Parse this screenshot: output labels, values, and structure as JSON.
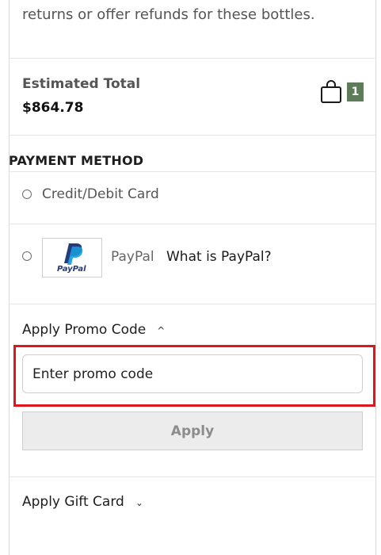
{
  "notice": {
    "text": "returns or offer refunds for these bottles."
  },
  "summary": {
    "estimated_total_label": "Estimated Total",
    "estimated_total_value": "$864.78",
    "cart_count": "1"
  },
  "payment": {
    "heading": "PAYMENT METHOD",
    "options": [
      {
        "label": "Credit/Debit Card"
      },
      {
        "label": "PayPal",
        "link": "What is PayPal?",
        "logo_text": "PayPal"
      }
    ]
  },
  "promo": {
    "toggle_label": "Apply Promo Code",
    "input_placeholder": "Enter promo code",
    "apply_label": "Apply"
  },
  "gift_card": {
    "toggle_label": "Apply Gift Card"
  },
  "colors": {
    "badge": "#5f7c5a",
    "highlight": "#e0161f",
    "paypal_dark": "#253b80",
    "paypal_light": "#179bd7"
  }
}
